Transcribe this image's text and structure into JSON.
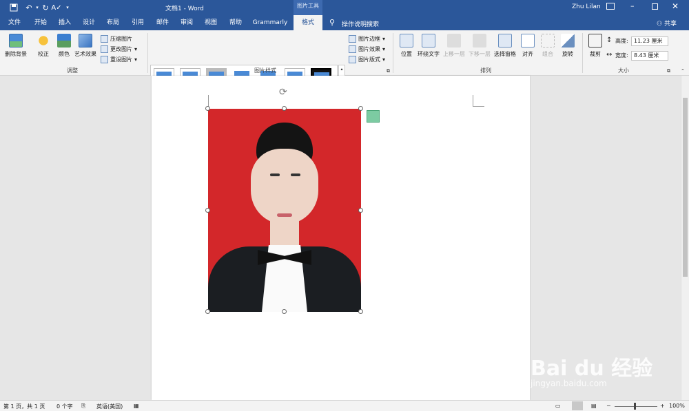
{
  "title_bar": {
    "title": "文档1  -  Word",
    "context_tools": "图片工具",
    "user": "Zhu Lilan"
  },
  "tabs": [
    "文件",
    "开始",
    "插入",
    "设计",
    "布局",
    "引用",
    "邮件",
    "审阅",
    "视图",
    "帮助",
    "Grammarly",
    "格式"
  ],
  "active_tab": "格式",
  "tell_me": "操作说明搜索",
  "share": "共享",
  "ribbon": {
    "adjust": {
      "remove_bg": "删除背景",
      "correct": "校正",
      "color": "颜色",
      "artistic": "艺术效果",
      "compress": "压缩图片",
      "change": "更改图片",
      "reset": "重设图片",
      "label": "调整"
    },
    "styles": {
      "border": "图片边框",
      "effects": "图片效果",
      "layout": "图片版式",
      "label": "图片样式"
    },
    "arrange": {
      "position": "位置",
      "wrap": "环绕文字",
      "forward": "上移一层",
      "backward": "下移一层",
      "selection": "选择窗格",
      "align": "对齐",
      "group": "组合",
      "rotate": "旋转",
      "label": "排列"
    },
    "size": {
      "crop": "裁剪",
      "height_label": "高度:",
      "height": "11.23 厘米",
      "width_label": "宽度:",
      "width": "8.43 厘米",
      "label": "大小"
    }
  },
  "status": {
    "page": "第 1 页，共 1 页",
    "words": "0 个字",
    "lang": "英语(美国)",
    "zoom": "100%"
  },
  "watermark": {
    "brand": "Bai du 经验",
    "url": "jingyan.baidu.com"
  },
  "colors": {
    "accent": "#2b579a",
    "photo_bg": "#d3272a",
    "layout_icon": "#7ccba2"
  }
}
